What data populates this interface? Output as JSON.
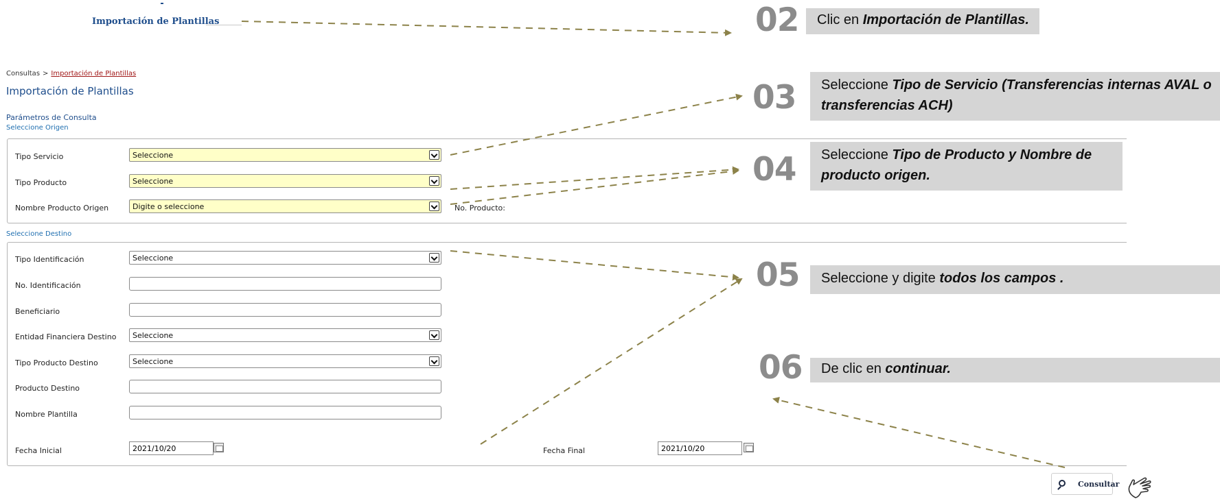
{
  "menu": {
    "link": "Importación de Plantillas"
  },
  "breadcrumb": {
    "parent": "Consultas",
    "separator": ">",
    "current": "Importación de Plantillas"
  },
  "page_title": "Importación de Plantillas",
  "params_title": "Parámetros de Consulta",
  "origin": {
    "section_title": "Seleccione Origen",
    "tipo_servicio": {
      "label": "Tipo Servicio",
      "value": "Seleccione"
    },
    "tipo_producto": {
      "label": "Tipo Producto",
      "value": "Seleccione"
    },
    "nombre_producto": {
      "label": "Nombre Producto Origen",
      "value": "Digite o seleccione"
    },
    "no_producto_label": "No. Producto:"
  },
  "destination": {
    "section_title": "Seleccione Destino",
    "tipo_identificacion": {
      "label": "Tipo Identificación",
      "value": "Seleccione"
    },
    "no_identificacion": {
      "label": "No. Identificación",
      "value": ""
    },
    "beneficiario": {
      "label": "Beneficiario",
      "value": ""
    },
    "entidad": {
      "label": "Entidad Financiera Destino",
      "value": "Seleccione"
    },
    "tipo_producto_destino": {
      "label": "Tipo Producto Destino",
      "value": "Seleccione"
    },
    "producto_destino": {
      "label": "Producto Destino",
      "value": ""
    },
    "nombre_plantilla": {
      "label": "Nombre Plantilla",
      "value": ""
    },
    "fecha_inicial": {
      "label": "Fecha Inicial",
      "value": "2021/10/20"
    },
    "fecha_final": {
      "label": "Fecha Final",
      "value": "2021/10/20"
    }
  },
  "consult_button": {
    "label": "Consultar"
  },
  "steps": [
    {
      "num": "02",
      "text": "Clic en ",
      "bold": "Importación de Plantillas."
    },
    {
      "num": "03",
      "text": "Seleccione ",
      "bold": "Tipo de Servicio (Transferencias internas AVAL o transferencias ACH)"
    },
    {
      "num": "04",
      "text": "Seleccione ",
      "bold": "Tipo de Producto y Nombre de producto origen."
    },
    {
      "num": "05",
      "text": "Seleccione  y digite ",
      "bold": "todos los campos ."
    },
    {
      "num": "06",
      "text": "De clic en ",
      "bold": "continuar."
    }
  ],
  "colors": {
    "arrow": "#8c8249",
    "banner": "#d5d5d5",
    "step_number": "#8c8c8c",
    "link": "#1f4e8c",
    "highlight_field": "#ffffc8"
  },
  "icons": [
    "chevron-down-icon",
    "calendar-icon",
    "search-icon",
    "hand-pointer-icon"
  ]
}
